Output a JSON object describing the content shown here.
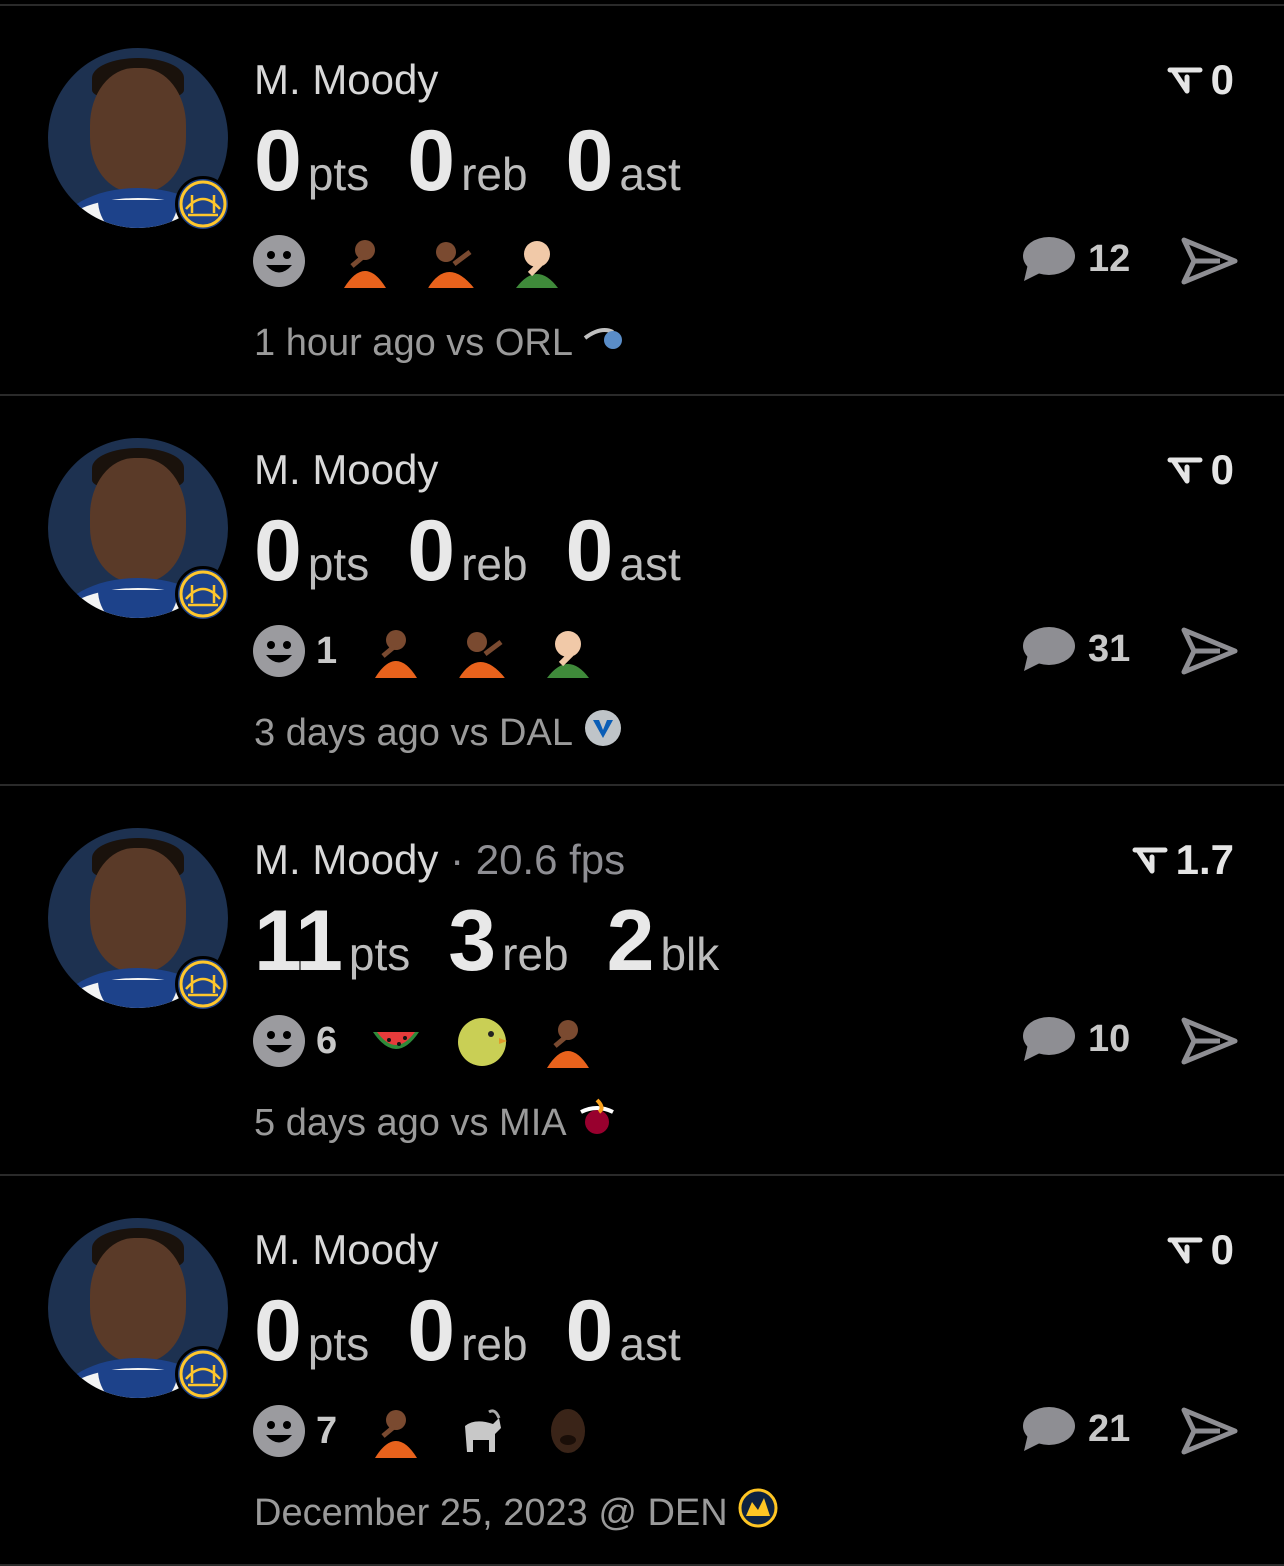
{
  "feed": [
    {
      "player": "M. Moody",
      "fps": "",
      "score": "0",
      "stats": [
        {
          "value": "0",
          "label": "pts"
        },
        {
          "value": "0",
          "label": "reb"
        },
        {
          "value": "0",
          "label": "ast"
        }
      ],
      "reaction_count": "",
      "reactions": [
        "drake-no-icon",
        "drake-yes-icon",
        "success-kid-icon"
      ],
      "comments": "12",
      "meta": "1 hour ago vs ORL",
      "opponent_logo": "orlando-magic-logo"
    },
    {
      "player": "M. Moody",
      "fps": "",
      "score": "0",
      "stats": [
        {
          "value": "0",
          "label": "pts"
        },
        {
          "value": "0",
          "label": "reb"
        },
        {
          "value": "0",
          "label": "ast"
        }
      ],
      "reaction_count": "1",
      "reactions": [
        "drake-no-icon",
        "drake-yes-icon",
        "success-kid-icon"
      ],
      "comments": "31",
      "meta": "3 days ago vs DAL",
      "opponent_logo": "dallas-mavericks-logo"
    },
    {
      "player": "M. Moody",
      "fps": "· 20.6 fps",
      "score": "1.7",
      "stats": [
        {
          "value": "11",
          "label": "pts"
        },
        {
          "value": "3",
          "label": "reb"
        },
        {
          "value": "2",
          "label": "blk"
        }
      ],
      "reaction_count": "6",
      "reactions": [
        "watermelon-icon",
        "chick-icon",
        "drake-no-icon"
      ],
      "comments": "10",
      "meta": "5 days ago vs MIA",
      "opponent_logo": "miami-heat-logo"
    },
    {
      "player": "M. Moody",
      "fps": "",
      "score": "0",
      "stats": [
        {
          "value": "0",
          "label": "pts"
        },
        {
          "value": "0",
          "label": "reb"
        },
        {
          "value": "0",
          "label": "ast"
        }
      ],
      "reaction_count": "7",
      "reactions": [
        "drake-no-icon",
        "goat-icon",
        "crying-jordan-icon"
      ],
      "comments": "21",
      "meta": "December 25, 2023 @ DEN",
      "opponent_logo": "denver-nuggets-logo"
    }
  ],
  "colors": {
    "background": "#000000",
    "text_primary": "#e8e8e8",
    "text_secondary": "#9a9a9a",
    "icon_gray": "#8e8e93",
    "warriors_blue": "#1d428a",
    "warriors_gold": "#ffc72c"
  }
}
